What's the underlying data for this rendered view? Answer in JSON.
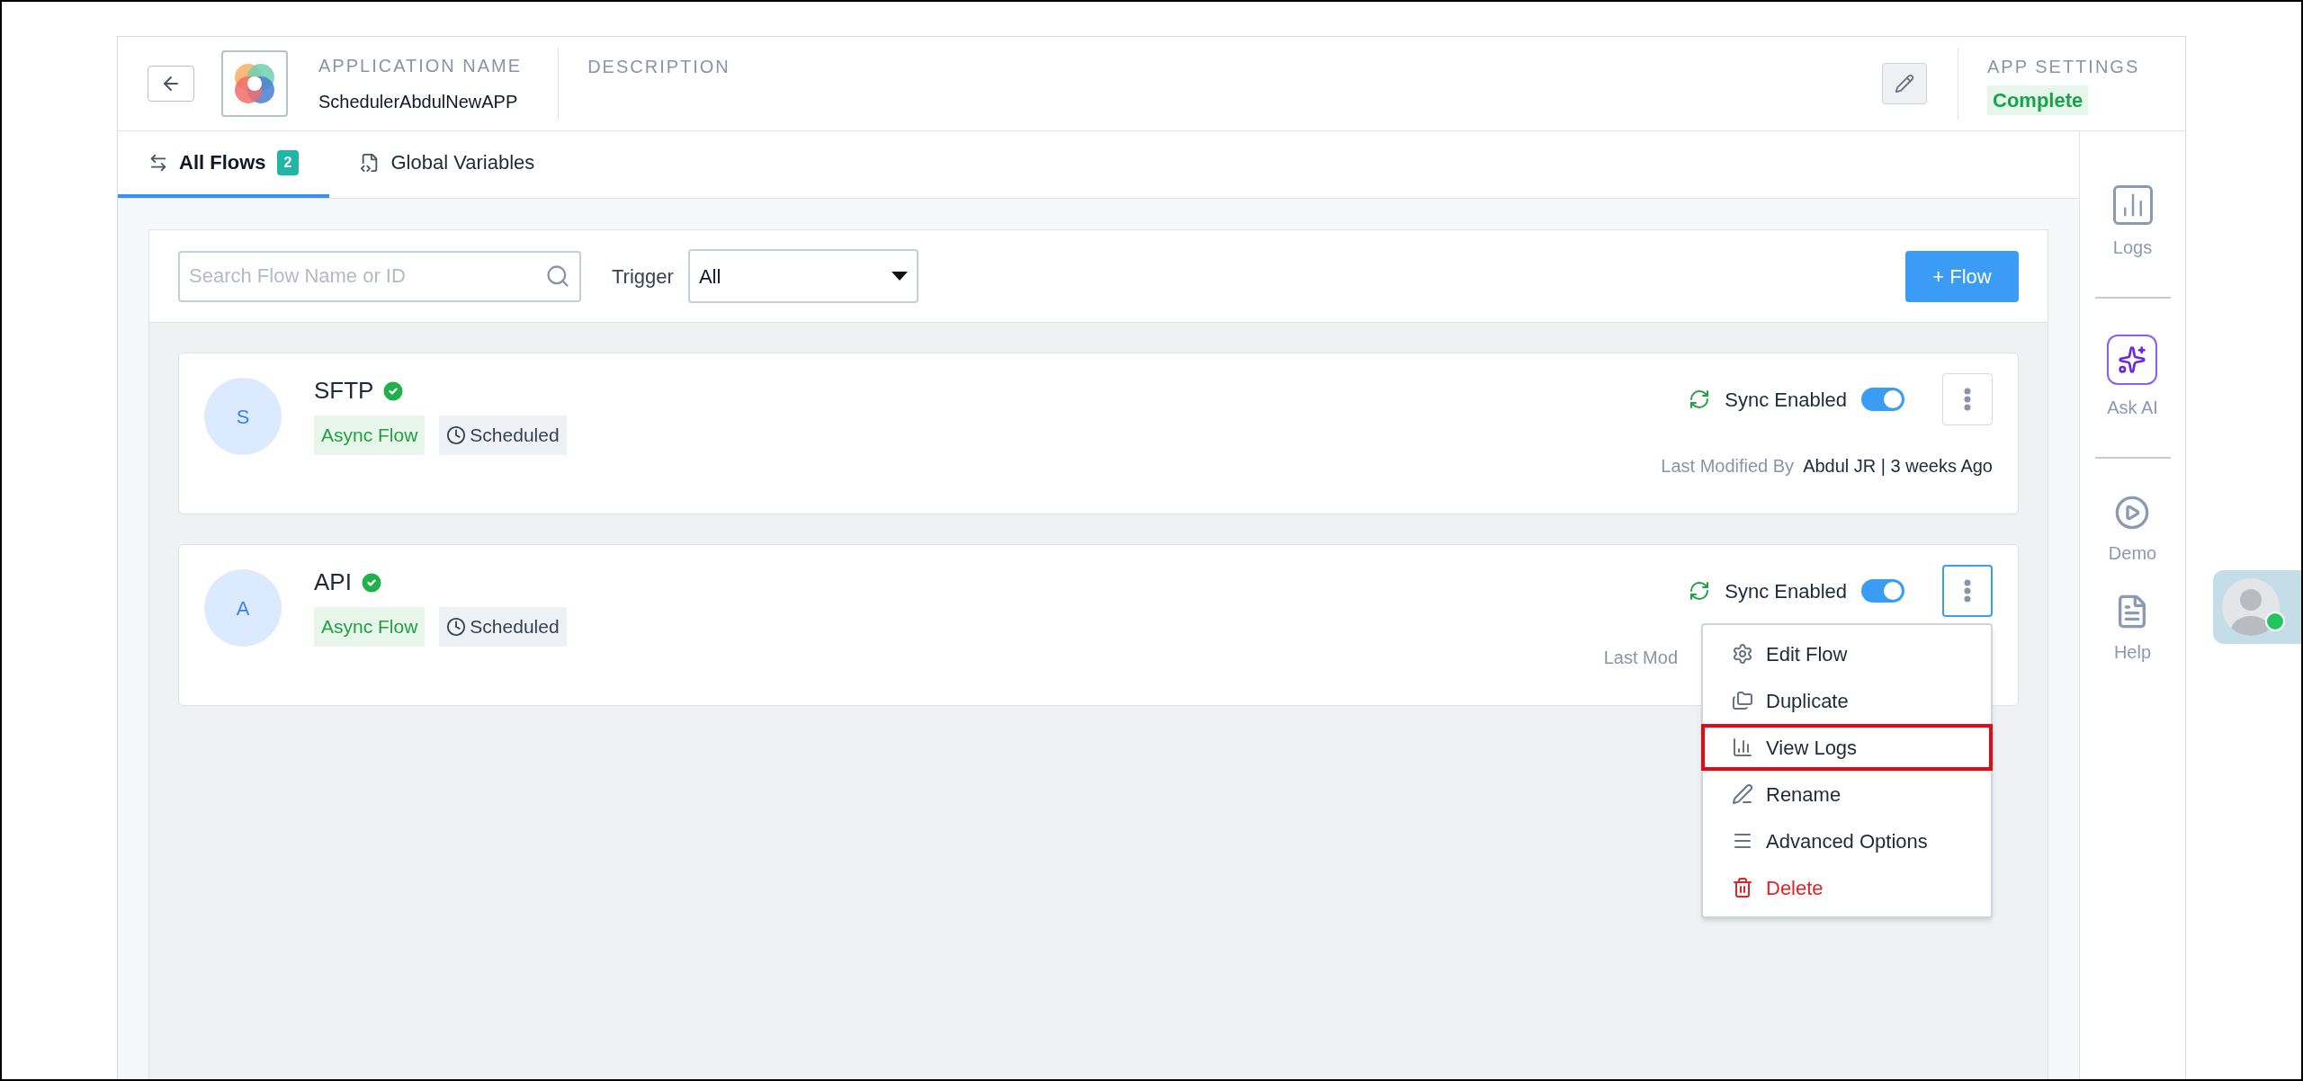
{
  "header": {
    "app_name_label": "APPLICATION NAME",
    "app_name": "SchedulerAbdulNewAPP",
    "description_label": "DESCRIPTION",
    "settings_label": "APP SETTINGS",
    "settings_status": "Complete"
  },
  "tabs": [
    {
      "label": "All Flows",
      "count": "2",
      "selected": true,
      "kind": "flows"
    },
    {
      "label": "Global Variables",
      "selected": false,
      "kind": "variables"
    }
  ],
  "toolbar": {
    "search": {
      "placeholder": "Search Flow Name or ID"
    },
    "trigger_label": "Trigger",
    "trigger_value": "All",
    "add_button": "+ Flow"
  },
  "flows": [
    {
      "initial": "S",
      "name": "SFTP",
      "verified": true,
      "type_tag": "Async Flow",
      "schedule_tag": "Scheduled",
      "sync_label": "Sync Enabled",
      "sync_on": true,
      "menu_focused": false,
      "modified_label": "Last Modified By",
      "modified_by": "Abdul JR | 3 weeks Ago"
    },
    {
      "initial": "A",
      "name": "API",
      "verified": true,
      "type_tag": "Async Flow",
      "schedule_tag": "Scheduled",
      "sync_label": "Sync Enabled",
      "sync_on": true,
      "menu_focused": true,
      "modified_label": "Last Mod"
    }
  ],
  "menu": [
    {
      "label": "Edit Flow",
      "kind": "gear",
      "highlighted": false,
      "danger": false
    },
    {
      "label": "Duplicate",
      "kind": "folder",
      "highlighted": false,
      "danger": false
    },
    {
      "label": "View Logs",
      "kind": "chart",
      "highlighted": true,
      "danger": false
    },
    {
      "label": "Rename",
      "kind": "pen",
      "highlighted": false,
      "danger": false
    },
    {
      "label": "Advanced Options",
      "kind": "lines",
      "highlighted": false,
      "danger": false
    },
    {
      "label": "Delete",
      "kind": "trash",
      "highlighted": false,
      "danger": true
    }
  ],
  "sidebar": [
    {
      "label": "Logs",
      "kind": "logs"
    },
    {
      "label": "Ask AI",
      "kind": "ai"
    },
    {
      "label": "Demo",
      "kind": "demo"
    },
    {
      "label": "Help",
      "kind": "help"
    }
  ]
}
